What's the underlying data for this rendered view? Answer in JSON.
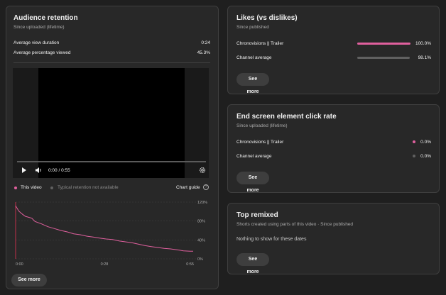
{
  "retention": {
    "title": "Audience retention",
    "subtitle": "Since uploaded (lifetime)",
    "stats": [
      {
        "label": "Average view duration",
        "value": "0:24"
      },
      {
        "label": "Average percentage viewed",
        "value": "45.3%"
      }
    ],
    "player": {
      "time": "0:00 / 0:55",
      "play_icon": "play-icon",
      "volume_icon": "volume-icon",
      "settings_icon": "gear-icon",
      "progress": 0
    },
    "legend": {
      "this_video": "This video",
      "typical": "Typical retention not available",
      "chart_guide": "Chart guide",
      "help_icon": "question-mark-icon",
      "series_color": "#e0609e"
    },
    "see_more": "See more"
  },
  "chart_data": {
    "type": "line",
    "x_ticks": [
      "0:00",
      "0:28",
      "0:55"
    ],
    "y_ticks": [
      "120%",
      "80%",
      "40%",
      "0%"
    ],
    "ylim": [
      0,
      120
    ],
    "xlim": [
      0,
      55
    ],
    "series": [
      {
        "name": "This video",
        "x": [
          0,
          1,
          2,
          3,
          5,
          6,
          8,
          10,
          12,
          14,
          16,
          18,
          20,
          22,
          24,
          26,
          28,
          30,
          32,
          34,
          36,
          38,
          40,
          42,
          44,
          46,
          48,
          50,
          52,
          54,
          55
        ],
        "y": [
          112,
          101,
          95,
          90,
          86,
          79,
          74,
          68,
          64,
          60,
          57,
          53,
          51,
          48,
          46,
          44,
          42,
          41,
          38,
          36,
          34,
          31,
          28,
          26,
          24,
          22,
          21,
          19,
          17,
          16,
          16
        ]
      }
    ]
  },
  "likes": {
    "title": "Likes (vs dislikes)",
    "subtitle": "Since published",
    "rows": [
      {
        "label": "Chronovisions || Trailer",
        "value": "100.0%",
        "fraction": 1.0,
        "color": "#e0609e"
      },
      {
        "label": "Channel average",
        "value": "98.1%",
        "fraction": 0.981,
        "color": "#606060"
      }
    ],
    "see_more": "See more"
  },
  "end_screen": {
    "title": "End screen element click rate",
    "subtitle": "Since uploaded (lifetime)",
    "rows": [
      {
        "label": "Chronovisions || Trailer",
        "value": "0.0%",
        "color": "#e0609e"
      },
      {
        "label": "Channel average",
        "value": "0.0%",
        "color": "#606060"
      }
    ],
    "see_more": "See more"
  },
  "remixed": {
    "title": "Top remixed",
    "subtitle": "Shorts created using parts of this video · Since published",
    "empty": "Nothing to show for these dates",
    "see_more": "See more"
  }
}
